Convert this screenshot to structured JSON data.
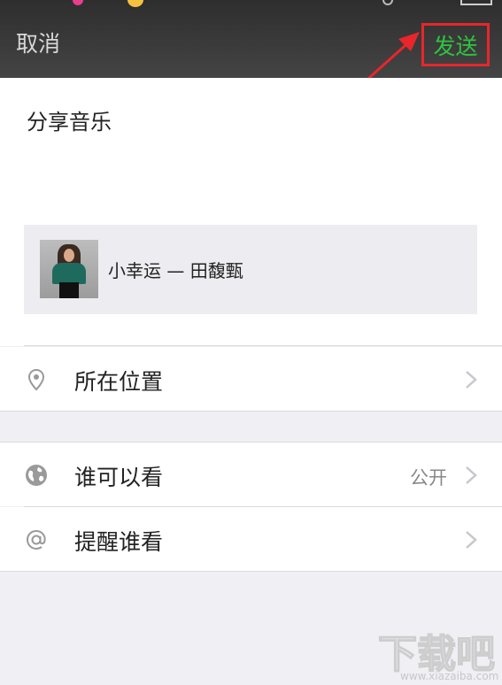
{
  "header": {
    "cancel_label": "取消",
    "send_label": "发送"
  },
  "compose": {
    "text": "分享音乐",
    "music": {
      "title": "小幸运 — 田馥甄"
    }
  },
  "options": [
    {
      "icon": "location-pin-icon",
      "label": "所在位置",
      "value": ""
    },
    {
      "icon": "globe-icon",
      "label": "谁可以看",
      "value": "公开"
    },
    {
      "icon": "at-sign-icon",
      "label": "提醒谁看",
      "value": ""
    }
  ],
  "watermark": {
    "logo_text": "下载吧",
    "url": "www.xiazaiba.com"
  },
  "colors": {
    "send_text": "#2fc43f",
    "highlight_box": "#e8262b",
    "header_bg": "#3a3a3a"
  }
}
